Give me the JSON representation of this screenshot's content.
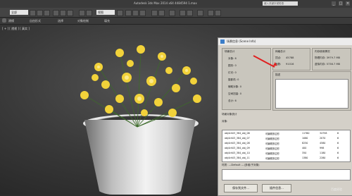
{
  "titlebar": {
    "app_title": "Autodesk 3ds Max 2014 x64    4484594 1.max",
    "search_placeholder": "键入关键字或短语",
    "buttons": [
      "_",
      "□",
      "×"
    ]
  },
  "toolbar": {
    "selection_filter": "全部",
    "view_dropdown": "视图"
  },
  "tabs": [
    "建模",
    "自由形式",
    "选择",
    "对象绘制",
    "填充"
  ],
  "viewport": {
    "label": "[ + ] [ 透视 ] [ 真实 ]"
  },
  "dialog": {
    "title": "场景信息 (Scene Info)",
    "scene_totals": {
      "caption": "场景总计",
      "rows": [
        "对象: 6",
        "图形: 0",
        "灯光: 0",
        "摄影机: 0",
        "辅助对象: 0",
        "空间扭曲: 0",
        "总计: 6"
      ]
    },
    "mesh_totals": {
      "caption": "网格总计",
      "vertices_label": "顶点:",
      "vertices_value": "45788",
      "faces_label": "面数:",
      "faces_value": "91016"
    },
    "memory": {
      "caption": "内存使用情况",
      "rows": [
        "物理内存: 3979.7 MB",
        "虚拟内存: 5736.7 MB"
      ]
    },
    "description_caption": "描述",
    "scene_objects_caption": "场景对象统计",
    "objects_label": "对象:",
    "objects": [
      [
        "obj4ch03_384_obj_06",
        "可编辑多边形",
        "11760",
        "34758",
        "6"
      ],
      [
        "obj4ch03_384_obj_07",
        "可编辑多边形",
        "1060",
        "2070",
        "6"
      ],
      [
        "obj4ch03_384_obj_08",
        "可编辑多边形",
        "8250",
        "4580",
        "6"
      ],
      [
        "obj4ch03_384_obj_09",
        "可编辑多边形",
        "400",
        "998",
        "6"
      ],
      [
        "obj4ch03_384_obj_10",
        "可编辑多边形",
        "350",
        "1180",
        "6"
      ],
      [
        "obj4ch03_384_obj_11",
        "可编辑多边形",
        "1380",
        "2280",
        "6"
      ]
    ],
    "modifier_caption": "材质: ---Default ---(多维/子对象)",
    "buttons": {
      "save": "保存到文件...",
      "plugin": "插件信息..."
    }
  },
  "watermark": "百度经验",
  "colors": {
    "accent": "#e02020",
    "flower": "#f2d23a"
  }
}
